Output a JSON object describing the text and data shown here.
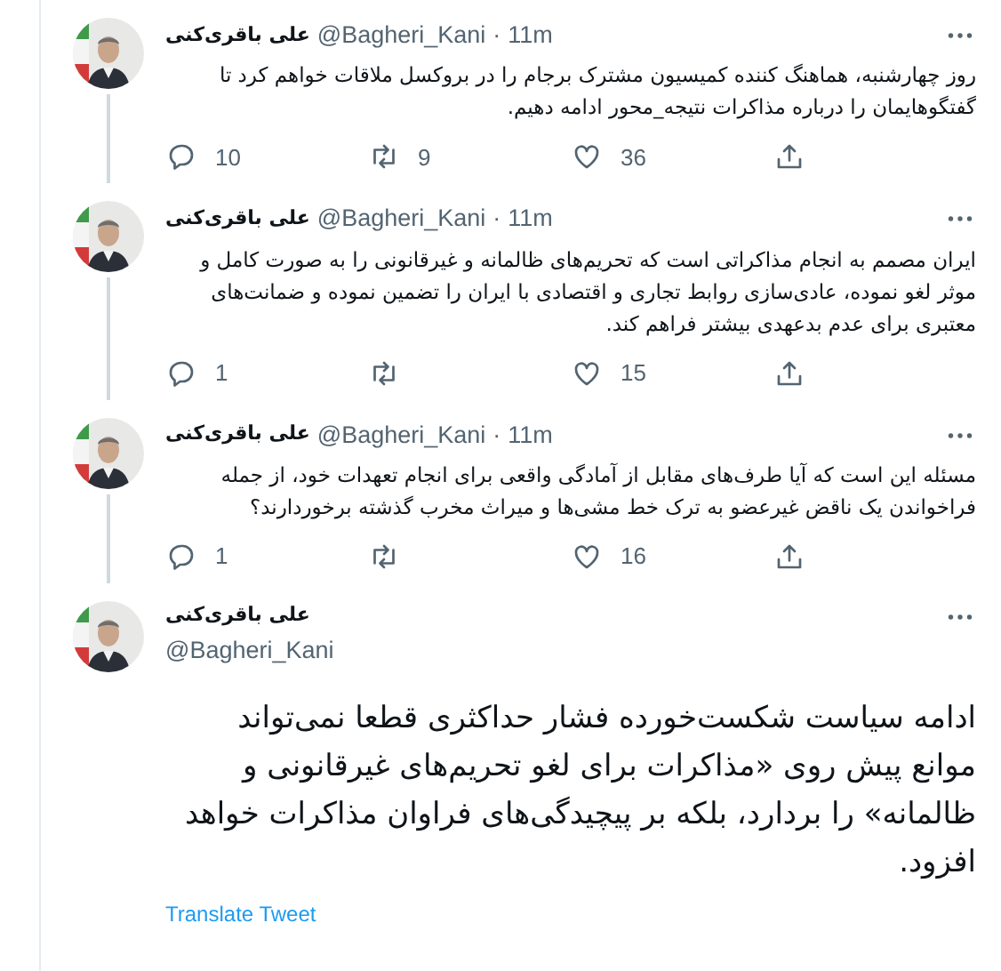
{
  "thread": [
    {
      "author": "علی باقری‌کنی",
      "handle": "@Bagheri_Kani",
      "separator": "·",
      "time": "11m",
      "text": "روز چهارشنبه، هماهنگ کننده کمیسیون مشترک برجام را در بروکسل ملاقات خواهم کرد تا گفتگوهایمان را درباره مذاکرات نتیجه_محور ادامه دهیم.",
      "replies": "10",
      "retweets": "9",
      "likes": "36"
    },
    {
      "author": "علی باقری‌کنی",
      "handle": "@Bagheri_Kani",
      "separator": "·",
      "time": "11m",
      "text": "ایران مصمم به انجام مذاکراتی است که تحریم‌های ظالمانه و غیرقانونی را به صورت کامل و موثر لغو نموده، عادی‌سازی روابط تجاری و اقتصادی با ایران را تضمین نموده و ضمانت‌های معتبری برای عدم بدعهدی بیشتر فراهم کند.",
      "replies": "1",
      "likes": "15"
    },
    {
      "author": "علی باقری‌کنی",
      "handle": "@Bagheri_Kani",
      "separator": "·",
      "time": "11m",
      "text": "مسئله این است که آیا طرف‌های مقابل از  آمادگی واقعی برای انجام تعهدات خود، از جمله فراخواندن یک ناقض غیرعضو به ترک خط مشی‌ها و میراث مخرب گذشته برخوردارند؟",
      "replies": "1",
      "likes": "16"
    }
  ],
  "main_tweet": {
    "author": "علی باقری‌کنی",
    "handle": "@Bagheri_Kani",
    "text": "ادامه سیاست شکست‌خورده فشار حداکثری قطعا نمی‌تواند موانع پیش روی «مذاکرات برای لغو تحریم‌های غیرقانونی و ظالمانه» را بردارد، بلکه بر پیچیدگی‌های فراوان مذاکرات خواهد افزود.",
    "translate": "Translate Tweet"
  }
}
